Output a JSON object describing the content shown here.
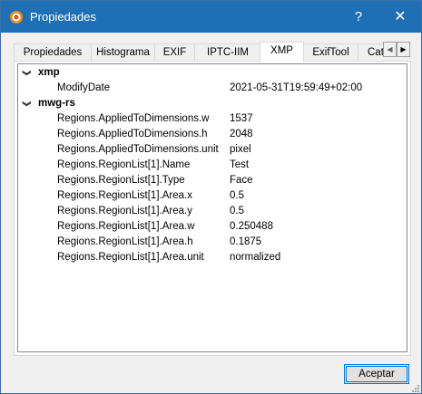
{
  "window": {
    "title": "Propiedades",
    "help_glyph": "?",
    "close_glyph": "✕"
  },
  "tabs": [
    {
      "label": "Propiedades",
      "active": false
    },
    {
      "label": "Histograma",
      "active": false
    },
    {
      "label": "EXIF",
      "active": false
    },
    {
      "label": "IPTC-IIM",
      "active": false
    },
    {
      "label": "XMP",
      "active": true
    },
    {
      "label": "ExifTool",
      "active": false
    },
    {
      "label": "Cat",
      "active": false
    }
  ],
  "tab_scroll": {
    "left_glyph": "◀",
    "right_glyph": "▶"
  },
  "tree": {
    "groups": [
      {
        "name": "xmp",
        "expanded": true,
        "entries": [
          {
            "key": "ModifyDate",
            "value": "2021-05-31T19:59:49+02:00"
          }
        ]
      },
      {
        "name": "mwg-rs",
        "expanded": true,
        "entries": [
          {
            "key": "Regions.AppliedToDimensions.w",
            "value": "1537"
          },
          {
            "key": "Regions.AppliedToDimensions.h",
            "value": "2048"
          },
          {
            "key": "Regions.AppliedToDimensions.unit",
            "value": "pixel"
          },
          {
            "key": "Regions.RegionList[1].Name",
            "value": "Test"
          },
          {
            "key": "Regions.RegionList[1].Type",
            "value": "Face"
          },
          {
            "key": "Regions.RegionList[1].Area.x",
            "value": "0.5"
          },
          {
            "key": "Regions.RegionList[1].Area.y",
            "value": "0.5"
          },
          {
            "key": "Regions.RegionList[1].Area.w",
            "value": "0.250488"
          },
          {
            "key": "Regions.RegionList[1].Area.h",
            "value": "0.1875"
          },
          {
            "key": "Regions.RegionList[1].Area.unit",
            "value": "normalized"
          }
        ]
      }
    ]
  },
  "buttons": {
    "accept": "Aceptar"
  }
}
